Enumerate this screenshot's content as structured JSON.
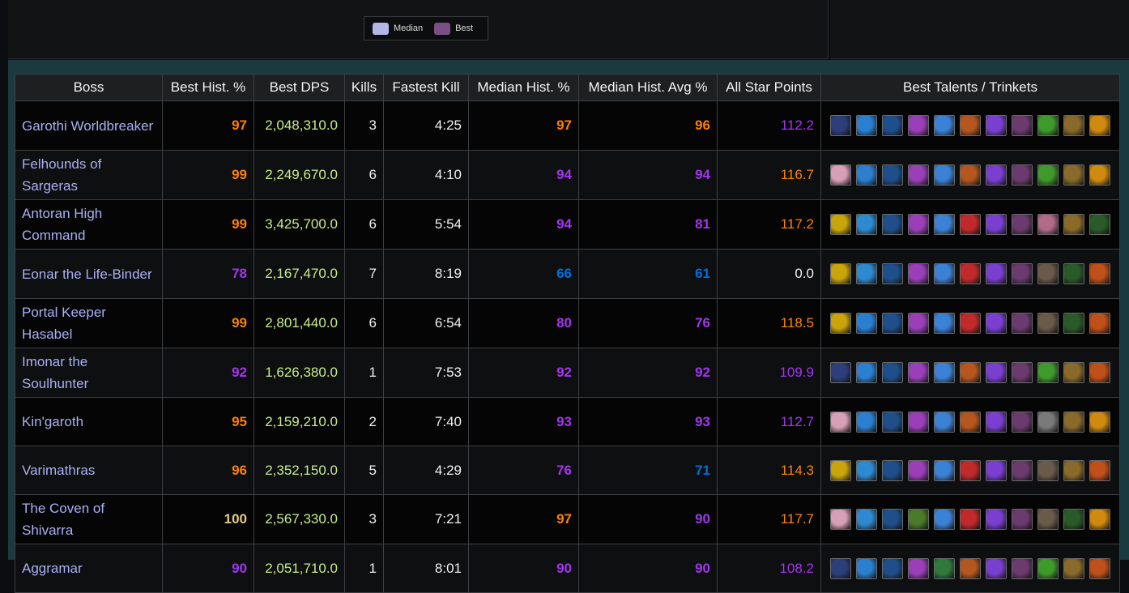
{
  "legend": {
    "median_label": "Median",
    "best_label": "Best",
    "median_color": "#b3b6e6",
    "best_color": "#7a4f86"
  },
  "table": {
    "headers": [
      "Boss",
      "Best Hist. %",
      "Best DPS",
      "Kills",
      "Fastest Kill",
      "Median Hist. %",
      "Median Hist. Avg %",
      "All Star Points",
      "Best Talents / Trinkets"
    ],
    "rows": [
      {
        "boss": "Garothi Worldbreaker",
        "best_hist": "97",
        "best_hist_color": "legendary",
        "best_dps": "2,048,310.0",
        "kills": "3",
        "fastest": "4:25",
        "median_hist": "97",
        "median_hist_color": "legendary",
        "median_avg": "96",
        "median_avg_color": "legendary",
        "star_points": "112.2",
        "star_color": "epic",
        "icons": [
          "deathknight-blue-icon",
          "frost-wolf-icon",
          "frost-spiral-icon",
          "purple-swirl-icon",
          "ice-claw-icon",
          "fire-beast-icon",
          "shadow-orb-icon",
          "void-rune-icon",
          "green-claw-icon",
          "bronze-helm-icon",
          "golden-crest-icon"
        ]
      },
      {
        "boss": "Felhounds of Sargeras",
        "best_hist": "99",
        "best_hist_color": "legendary",
        "best_dps": "2,249,670.0",
        "kills": "6",
        "fastest": "4:10",
        "median_hist": "94",
        "median_hist_color": "epic",
        "median_avg": "94",
        "median_avg_color": "epic",
        "star_points": "116.7",
        "star_color": "legendary",
        "icons": [
          "pink-flower-icon",
          "frost-wolf-icon",
          "frost-spiral-icon",
          "purple-swirl-icon",
          "ice-claw-icon",
          "fire-beast-icon",
          "shadow-orb-icon",
          "void-rune-icon",
          "green-claw-icon",
          "bronze-helm-icon",
          "golden-crest-icon"
        ]
      },
      {
        "boss": "Antoran High Command",
        "best_hist": "99",
        "best_hist_color": "legendary",
        "best_dps": "3,425,700.0",
        "kills": "6",
        "fastest": "5:54",
        "median_hist": "94",
        "median_hist_color": "epic",
        "median_avg": "81",
        "median_avg_color": "epic",
        "star_points": "117.2",
        "star_color": "legendary",
        "icons": [
          "yellow-beast-icon",
          "frost-leaf-icon",
          "frost-spiral-icon",
          "purple-swirl-icon",
          "ice-claw-icon",
          "red-strike-icon",
          "shadow-orb-icon",
          "void-rune-icon",
          "pink-bow-icon",
          "bronze-helm-icon",
          "green-cloak-icon"
        ]
      },
      {
        "boss": "Eonar the Life-Binder",
        "best_hist": "78",
        "best_hist_color": "epic",
        "best_dps": "2,167,470.0",
        "kills": "7",
        "fastest": "8:19",
        "median_hist": "66",
        "median_hist_color": "rare",
        "median_avg": "61",
        "median_avg_color": "rare",
        "star_points": "0.0",
        "star_color": "plain",
        "icons": [
          "yellow-beast-icon",
          "frost-leaf-icon",
          "frost-spiral-icon",
          "purple-swirl-icon",
          "ice-claw-icon",
          "red-strike-icon",
          "shadow-orb-icon",
          "void-rune-icon",
          "horn-icon",
          "green-cloak-icon",
          "fire-helm-icon"
        ]
      },
      {
        "boss": "Portal Keeper Hasabel",
        "best_hist": "99",
        "best_hist_color": "legendary",
        "best_dps": "2,801,440.0",
        "kills": "6",
        "fastest": "6:54",
        "median_hist": "80",
        "median_hist_color": "epic",
        "median_avg": "76",
        "median_avg_color": "epic",
        "star_points": "118.5",
        "star_color": "legendary",
        "icons": [
          "yellow-beast-icon",
          "frost-wolf-icon",
          "frost-spiral-icon",
          "purple-swirl-icon",
          "ice-claw-icon",
          "red-strike-icon",
          "shadow-orb-icon",
          "void-rune-icon",
          "horn-icon",
          "green-cloak-icon",
          "fire-helm-icon"
        ]
      },
      {
        "boss": "Imonar the Soulhunter",
        "best_hist": "92",
        "best_hist_color": "epic",
        "best_dps": "1,626,380.0",
        "kills": "1",
        "fastest": "7:53",
        "median_hist": "92",
        "median_hist_color": "epic",
        "median_avg": "92",
        "median_avg_color": "epic",
        "star_points": "109.9",
        "star_color": "epic",
        "icons": [
          "deathknight-blue-icon",
          "frost-wolf-icon",
          "frost-spiral-icon",
          "purple-swirl-icon",
          "ice-claw-icon",
          "fire-beast-icon",
          "shadow-orb-icon",
          "void-rune-icon",
          "green-claw-icon",
          "bronze-helm-icon",
          "fire-helm-icon"
        ]
      },
      {
        "boss": "Kin'garoth",
        "best_hist": "95",
        "best_hist_color": "legendary",
        "best_dps": "2,159,210.0",
        "kills": "2",
        "fastest": "7:40",
        "median_hist": "93",
        "median_hist_color": "epic",
        "median_avg": "93",
        "median_avg_color": "epic",
        "star_points": "112.7",
        "star_color": "epic",
        "icons": [
          "pink-flower-icon",
          "frost-wolf-icon",
          "frost-spiral-icon",
          "purple-swirl-icon",
          "ice-claw-icon",
          "fire-beast-icon",
          "shadow-orb-icon",
          "void-rune-icon",
          "bow-icon",
          "bronze-helm-icon",
          "golden-crest-icon"
        ]
      },
      {
        "boss": "Varimathras",
        "best_hist": "96",
        "best_hist_color": "legendary",
        "best_dps": "2,352,150.0",
        "kills": "5",
        "fastest": "4:29",
        "median_hist": "76",
        "median_hist_color": "epic",
        "median_avg": "71",
        "median_avg_color": "rare",
        "star_points": "114.3",
        "star_color": "legendary",
        "icons": [
          "yellow-beast-icon",
          "frost-leaf-icon",
          "frost-spiral-icon",
          "purple-swirl-icon",
          "ice-claw-icon",
          "red-strike-icon",
          "shadow-orb-icon",
          "void-rune-icon",
          "horn-icon",
          "bronze-helm-icon",
          "fire-helm-icon"
        ]
      },
      {
        "boss": "The Coven of Shivarra",
        "best_hist": "100",
        "best_hist_color": "artifact",
        "best_dps": "2,567,330.0",
        "kills": "3",
        "fastest": "7:21",
        "median_hist": "97",
        "median_hist_color": "legendary",
        "median_avg": "90",
        "median_avg_color": "epic",
        "star_points": "117.7",
        "star_color": "legendary",
        "icons": [
          "pink-flower-icon",
          "frost-leaf-icon",
          "frost-spiral-icon",
          "green-golem-icon",
          "ice-claw-icon",
          "red-strike-icon",
          "shadow-orb-icon",
          "void-rune-icon",
          "horn-icon",
          "green-cloak-icon",
          "golden-crest-icon"
        ]
      },
      {
        "boss": "Aggramar",
        "best_hist": "90",
        "best_hist_color": "epic",
        "best_dps": "2,051,710.0",
        "kills": "1",
        "fastest": "8:01",
        "median_hist": "90",
        "median_hist_color": "epic",
        "median_avg": "90",
        "median_avg_color": "epic",
        "star_points": "108.2",
        "star_color": "epic",
        "icons": [
          "deathknight-blue-icon",
          "frost-wolf-icon",
          "frost-spiral-icon",
          "purple-swirl-icon",
          "green-strike-icon",
          "fire-beast-icon",
          "shadow-orb-icon",
          "void-rune-icon",
          "green-claw-icon",
          "bronze-helm-icon",
          "fire-helm-icon"
        ]
      }
    ]
  },
  "icon_colors": {
    "deathknight-blue-icon": "#2c3f7a",
    "frost-wolf-icon": "#2a7fd0",
    "frost-spiral-icon": "#1e4f8a",
    "purple-swirl-icon": "#9a3fb8",
    "ice-claw-icon": "#3b82d6",
    "fire-beast-icon": "#b5561f",
    "shadow-orb-icon": "#7a3fd1",
    "void-rune-icon": "#6b3a6e",
    "green-claw-icon": "#3e9a2a",
    "bronze-helm-icon": "#8a6a2a",
    "golden-crest-icon": "#d08a10",
    "pink-flower-icon": "#d8a0b8",
    "yellow-beast-icon": "#c9a50a",
    "frost-leaf-icon": "#2d8ad0",
    "red-strike-icon": "#c02a2a",
    "pink-bow-icon": "#b06a8a",
    "green-cloak-icon": "#2a5a2a",
    "horn-icon": "#6a5a4a",
    "fire-helm-icon": "#c0501a",
    "bow-icon": "#7a7a7a",
    "green-golem-icon": "#4a7a2a",
    "green-strike-icon": "#2f7a3a"
  }
}
